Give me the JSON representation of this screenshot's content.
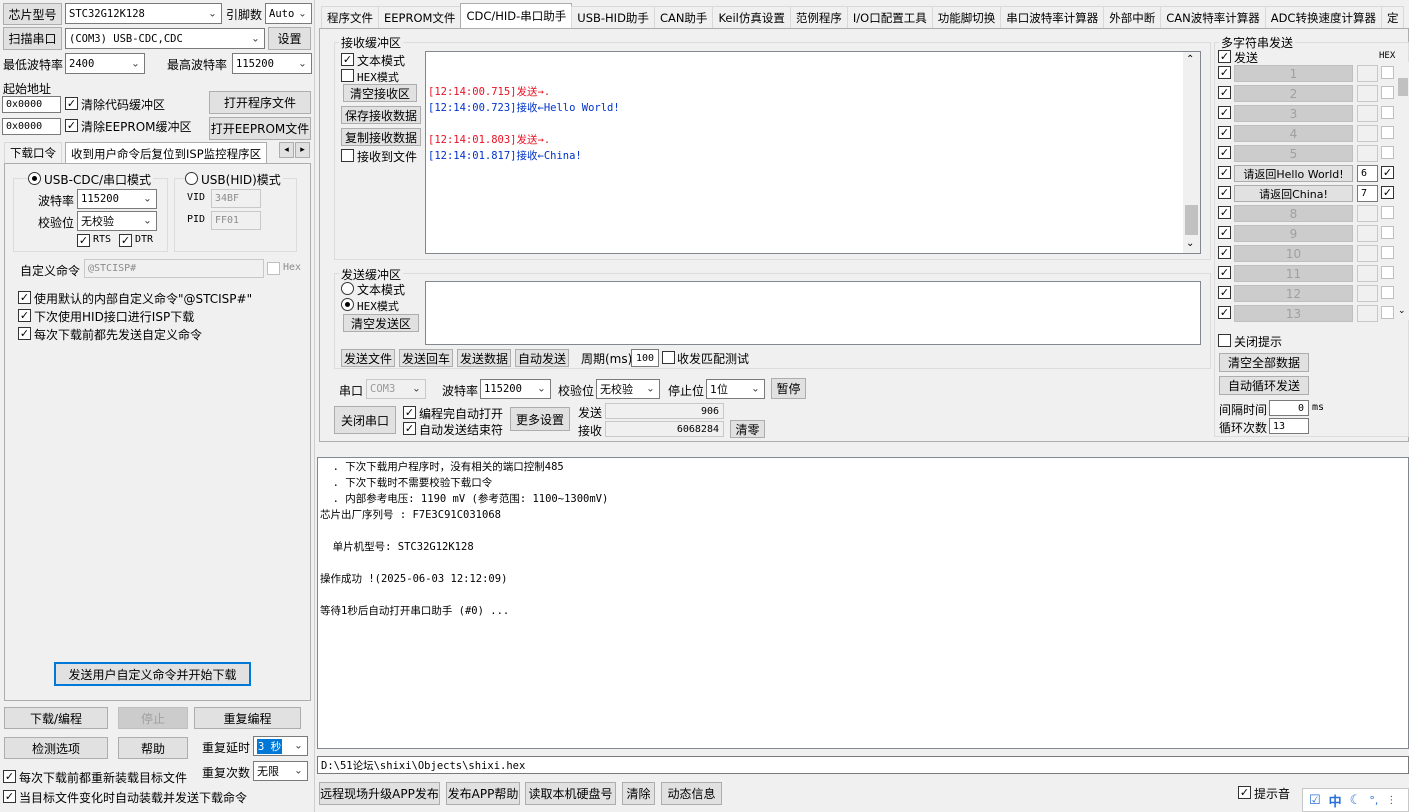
{
  "left": {
    "chip_label": "芯片型号",
    "chip_model": "STC32G12K128",
    "pin_label": "引脚数",
    "pin_value": "Auto",
    "scan_button": "扫描串口",
    "port_value": "(COM3) USB-CDC,CDC",
    "settings_button": "设置",
    "min_baud_label": "最低波特率",
    "min_baud": "2400",
    "max_baud_label": "最高波特率",
    "max_baud": "115200",
    "start_addr_label": "起始地址",
    "addr1": "0x0000",
    "clear_code": "清除代码缓冲区",
    "open_prog": "打开程序文件",
    "addr2": "0x0000",
    "clear_eeprom": "清除EEPROM缓冲区",
    "open_eeprom": "打开EEPROM文件",
    "tab1": "下载口令",
    "tab2": "收到用户命令后复位到ISP监控程序区",
    "usb_cdc_mode": "USB-CDC/串口模式",
    "usb_hid_mode": "USB(HID)模式",
    "baud_label": "波特率",
    "baud": "115200",
    "parity_label": "校验位",
    "parity": "无校验",
    "vid_label": "VID",
    "vid": "34BF",
    "pid_label": "PID",
    "pid": "FF01",
    "rts": "RTS",
    "dtr": "DTR",
    "custom_cmd_label": "自定义命令",
    "custom_cmd": "@STCISP#",
    "hex": "Hex",
    "opt1": "使用默认的内部自定义命令\"@STCISP#\"",
    "opt2": "下次使用HID接口进行ISP下载",
    "opt3": "每次下载前都先发送自定义命令",
    "send_custom_btn": "发送用户自定义命令并开始下载",
    "download_btn": "下载/编程",
    "stop_btn": "停止",
    "reprogram_btn": "重复编程",
    "check_btn": "检测选项",
    "help_btn": "帮助",
    "repeat_delay_label": "重复延时",
    "repeat_delay": "3 秒",
    "repeat_count_label": "重复次数",
    "repeat_count": "无限",
    "reload_opt": "每次下载前都重新装载目标文件",
    "auto_load_opt": "当目标文件变化时自动装载并发送下载命令"
  },
  "tabs": [
    "程序文件",
    "EEPROM文件",
    "CDC/HID-串口助手",
    "USB-HID助手",
    "CAN助手",
    "Keil仿真设置",
    "范例程序",
    "I/O口配置工具",
    "功能脚切换",
    "串口波特率计算器",
    "外部中断",
    "CAN波特率计算器",
    "ADC转换速度计算器",
    "定"
  ],
  "recv": {
    "group_label": "接收缓冲区",
    "text_mode": "文本模式",
    "hex_mode": "HEX模式",
    "clear_btn": "清空接收区",
    "save_btn": "保存接收数据",
    "copy_btn": "复制接收数据",
    "to_file": "接收到文件",
    "lines": [
      {
        "text": "",
        "color": ""
      },
      {
        "text": "[12:14:00.715]发送→.",
        "color": "red"
      },
      {
        "text": "[12:14:00.723]接收←Hello World!",
        "color": "blue"
      },
      {
        "text": "",
        "color": ""
      },
      {
        "text": "[12:14:01.803]发送→.",
        "color": "red"
      },
      {
        "text": "[12:14:01.817]接收←China!",
        "color": "blue"
      }
    ]
  },
  "send": {
    "group_label": "发送缓冲区",
    "text_mode": "文本模式",
    "hex_mode": "HEX模式",
    "clear_btn": "清空发送区",
    "send_file": "发送文件",
    "send_cr": "发送回车",
    "send_data": "发送数据",
    "auto_send": "自动发送",
    "period_label": "周期(ms)",
    "period": "100",
    "match_test": "收发匹配测试"
  },
  "port": {
    "port_label": "串口",
    "port": "COM3",
    "baud_label": "波特率",
    "baud": "115200",
    "parity_label": "校验位",
    "parity": "无校验",
    "stop_label": "停止位",
    "stop": "1位",
    "pause_btn": "暂停",
    "close_btn": "关闭串口",
    "auto_open": "编程完自动打开",
    "auto_end": "自动发送结束符",
    "more_btn": "更多设置",
    "sent_label": "发送",
    "sent": "906",
    "recv_label": "接收",
    "recv": "6068284",
    "clear_btn": "清零"
  },
  "multi": {
    "title": "多字符串发送",
    "send": "发送",
    "hex": "HEX",
    "rows": [
      {
        "label": "1",
        "num": "",
        "enabled": false,
        "hex": false
      },
      {
        "label": "2",
        "num": "",
        "enabled": false,
        "hex": false
      },
      {
        "label": "3",
        "num": "",
        "enabled": false,
        "hex": false
      },
      {
        "label": "4",
        "num": "",
        "enabled": false,
        "hex": false
      },
      {
        "label": "5",
        "num": "",
        "enabled": false,
        "hex": false
      },
      {
        "label": "请返回Hello World!",
        "num": "6",
        "enabled": true,
        "hex": true
      },
      {
        "label": "请返回China!",
        "num": "7",
        "enabled": true,
        "hex": true
      },
      {
        "label": "8",
        "num": "",
        "enabled": false,
        "hex": false
      },
      {
        "label": "9",
        "num": "",
        "enabled": false,
        "hex": false
      },
      {
        "label": "10",
        "num": "",
        "enabled": false,
        "hex": false
      },
      {
        "label": "11",
        "num": "",
        "enabled": false,
        "hex": false
      },
      {
        "label": "12",
        "num": "",
        "enabled": false,
        "hex": false
      },
      {
        "label": "13",
        "num": "",
        "enabled": false,
        "hex": false
      }
    ],
    "close_hint": "关闭提示",
    "clear_all": "清空全部数据",
    "auto_loop": "自动循环发送",
    "interval_label": "间隔时间",
    "interval": "0",
    "ms": "ms",
    "loop_label": "循环次数",
    "loop": "13"
  },
  "log": {
    "lines": [
      "  . 下次下载用户程序时，没有相关的端口控制485",
      "  . 下次下载时不需要校验下载口令",
      "  . 内部参考电压: 1190 mV (参考范围: 1100~1300mV)",
      "芯片出厂序列号 : F7E3C91C031068",
      "",
      "  单片机型号: STC32G12K128",
      "",
      "操作成功 !(2025-06-03 12:12:09)",
      "",
      "等待1秒后自动打开串口助手 (#0) ..."
    ]
  },
  "path": "D:\\51论坛\\shixi\\Objects\\shixi.hex",
  "bottom": {
    "upgrade_btn": "远程现场升级APP发布",
    "publish_btn": "发布APP帮助",
    "read_disk_btn": "读取本机硬盘号",
    "clear_btn": "清除",
    "dynamic_btn": "动态信息",
    "sound": "提示音",
    "ime": "中"
  }
}
